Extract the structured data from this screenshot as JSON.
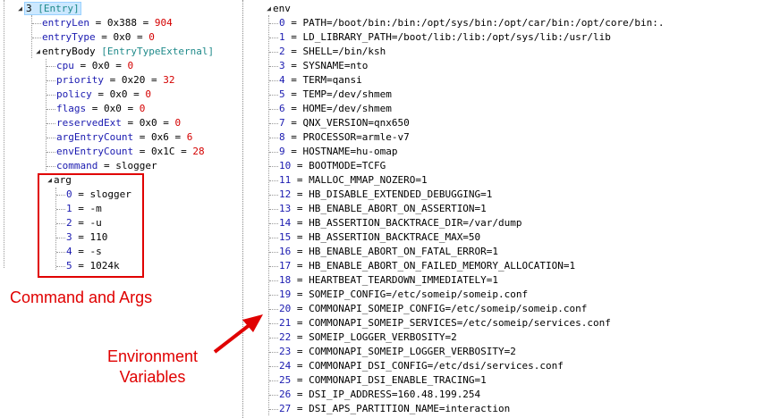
{
  "left": {
    "root": {
      "label": "3",
      "type": "[Entry]"
    },
    "entry_len": {
      "name": "entryLen",
      "hex": "0x388",
      "dec": "904"
    },
    "entry_type": {
      "name": "entryType",
      "hex": "0x0",
      "dec": "0"
    },
    "entry_body": {
      "name": "entryBody",
      "type": "[EntryTypeExternal]"
    },
    "cpu": {
      "name": "cpu",
      "hex": "0x0",
      "dec": "0"
    },
    "priority": {
      "name": "priority",
      "hex": "0x20",
      "dec": "32"
    },
    "policy": {
      "name": "policy",
      "hex": "0x0",
      "dec": "0"
    },
    "flags": {
      "name": "flags",
      "hex": "0x0",
      "dec": "0"
    },
    "reserved_ext": {
      "name": "reservedExt",
      "hex": "0x0",
      "dec": "0"
    },
    "arg_entry_count": {
      "name": "argEntryCount",
      "hex": "0x6",
      "dec": "6"
    },
    "env_entry_count": {
      "name": "envEntryCount",
      "hex": "0x1C",
      "dec": "28"
    },
    "command": {
      "name": "command",
      "value": "slogger"
    },
    "arg_node": {
      "name": "arg"
    },
    "args": [
      {
        "index": "0",
        "value": "slogger"
      },
      {
        "index": "1",
        "value": "-m"
      },
      {
        "index": "2",
        "value": "-u"
      },
      {
        "index": "3",
        "value": "110"
      },
      {
        "index": "4",
        "value": "-s"
      },
      {
        "index": "5",
        "value": "1024k"
      }
    ]
  },
  "right": {
    "env_node": {
      "name": "env"
    },
    "env": [
      {
        "index": "0",
        "value": "PATH=/boot/bin:/bin:/opt/sys/bin:/opt/car/bin:/opt/core/bin:."
      },
      {
        "index": "1",
        "value": "LD_LIBRARY_PATH=/boot/lib:/lib:/opt/sys/lib:/usr/lib"
      },
      {
        "index": "2",
        "value": "SHELL=/bin/ksh"
      },
      {
        "index": "3",
        "value": "SYSNAME=nto"
      },
      {
        "index": "4",
        "value": "TERM=qansi"
      },
      {
        "index": "5",
        "value": "TEMP=/dev/shmem"
      },
      {
        "index": "6",
        "value": "HOME=/dev/shmem"
      },
      {
        "index": "7",
        "value": "QNX_VERSION=qnx650"
      },
      {
        "index": "8",
        "value": "PROCESSOR=armle-v7"
      },
      {
        "index": "9",
        "value": "HOSTNAME=hu-omap"
      },
      {
        "index": "10",
        "value": "BOOTMODE=TCFG"
      },
      {
        "index": "11",
        "value": "MALLOC_MMAP_NOZERO=1"
      },
      {
        "index": "12",
        "value": "HB_DISABLE_EXTENDED_DEBUGGING=1"
      },
      {
        "index": "13",
        "value": "HB_ENABLE_ABORT_ON_ASSERTION=1"
      },
      {
        "index": "14",
        "value": "HB_ASSERTION_BACKTRACE_DIR=/var/dump"
      },
      {
        "index": "15",
        "value": "HB_ASSERTION_BACKTRACE_MAX=50"
      },
      {
        "index": "16",
        "value": "HB_ENABLE_ABORT_ON_FATAL_ERROR=1"
      },
      {
        "index": "17",
        "value": "HB_ENABLE_ABORT_ON_FAILED_MEMORY_ALLOCATION=1"
      },
      {
        "index": "18",
        "value": "HEARTBEAT_TEARDOWN_IMMEDIATELY=1"
      },
      {
        "index": "19",
        "value": "SOMEIP_CONFIG=/etc/someip/someip.conf"
      },
      {
        "index": "20",
        "value": "COMMONAPI_SOMEIP_CONFIG=/etc/someip/someip.conf"
      },
      {
        "index": "21",
        "value": "COMMONAPI_SOMEIP_SERVICES=/etc/someip/services.conf"
      },
      {
        "index": "22",
        "value": "SOMEIP_LOGGER_VERBOSITY=2"
      },
      {
        "index": "23",
        "value": "COMMONAPI_SOMEIP_LOGGER_VERBOSITY=2"
      },
      {
        "index": "24",
        "value": "COMMONAPI_DSI_CONFIG=/etc/dsi/services.conf"
      },
      {
        "index": "25",
        "value": "COMMONAPI_DSI_ENABLE_TRACING=1"
      },
      {
        "index": "26",
        "value": "DSI_IP_ADDRESS=160.48.199.254"
      },
      {
        "index": "27",
        "value": "DSI_APS_PARTITION_NAME=interaction"
      }
    ]
  },
  "annotations": {
    "command_and_args": "Command and Args",
    "env_line1": "Environment",
    "env_line2": "Variables"
  },
  "colors": {
    "annotation": "#e00000",
    "field_name": "#1a1ab0",
    "decimal_value": "#d40000",
    "type_tag": "#1f8a8a",
    "selection": "#cce8ff"
  }
}
